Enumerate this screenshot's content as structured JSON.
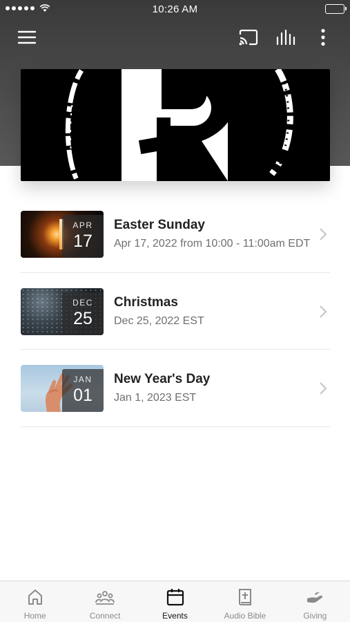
{
  "status_bar": {
    "time": "10:26 AM"
  },
  "toolbar": {
    "menu_icon": "hamburger-icon",
    "cast_icon": "cast-icon",
    "audio_icon": "equalizer-icon",
    "more_icon": "more-vertical-icon"
  },
  "hero": {
    "image": "church-logo-r-cross"
  },
  "events": [
    {
      "title": "Easter Sunday",
      "subtitle": "Apr 17, 2022 from 10:00 - 11:00am EDT",
      "month": "APR",
      "day": "17"
    },
    {
      "title": "Christmas",
      "subtitle": "Dec 25, 2022 EST",
      "month": "DEC",
      "day": "25"
    },
    {
      "title": "New Year's Day",
      "subtitle": "Jan 1, 2023 EST",
      "month": "JAN",
      "day": "01"
    }
  ],
  "tabs": [
    {
      "label": "Home",
      "icon": "home-icon"
    },
    {
      "label": "Connect",
      "icon": "people-icon"
    },
    {
      "label": "Events",
      "icon": "calendar-icon",
      "active": true
    },
    {
      "label": "Audio Bible",
      "icon": "bible-icon"
    },
    {
      "label": "Giving",
      "icon": "giving-hand-icon"
    }
  ],
  "colors": {
    "header": "#3a3a3a",
    "active_tab": "#111111",
    "inactive_tab": "#8a8a8a"
  }
}
